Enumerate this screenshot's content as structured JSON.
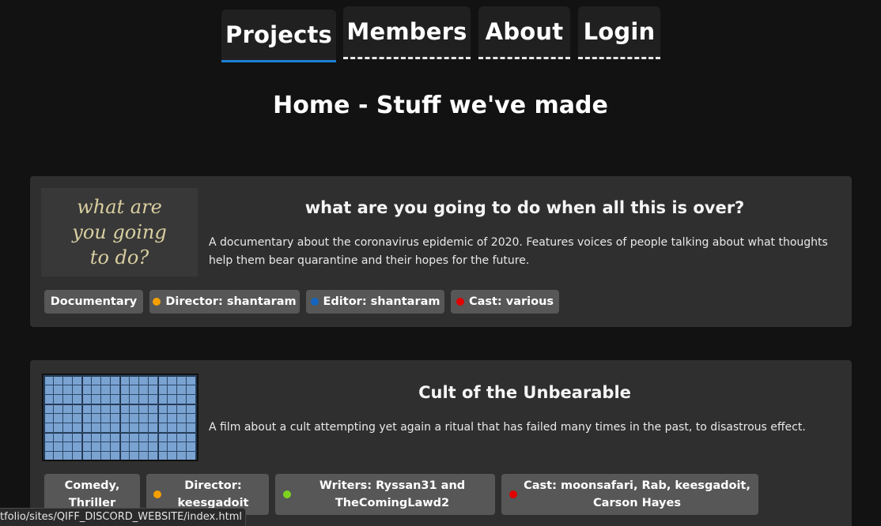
{
  "nav": {
    "tabs": [
      {
        "label": "Projects",
        "active": true
      },
      {
        "label": "Members",
        "active": false
      },
      {
        "label": "About",
        "active": false
      },
      {
        "label": "Login",
        "active": false
      }
    ]
  },
  "page": {
    "heading": "Home - Stuff we've made"
  },
  "projects": [
    {
      "thumbnail_lines": [
        "what are",
        "you going",
        "to do?"
      ],
      "title": "what are you going to do when all this is over?",
      "description": "A documentary about the coronavirus epidemic of 2020. Features voices of people talking about what thoughts help them bear quarantine and their hopes for the future.",
      "tags": [
        {
          "label": "Documentary"
        },
        {
          "label": "Director: shantaram",
          "dot_color": "#f5a000"
        },
        {
          "label": "Editor: shantaram",
          "dot_color": "#1565c0"
        },
        {
          "label": "Cast: various",
          "dot_color": "#e00000"
        }
      ]
    },
    {
      "thumbnail": "blue-grid-image",
      "title": "Cult of the Unbearable",
      "description": "A film about a cult attempting yet again a ritual that has failed many times in the past, to disastrous effect.",
      "tags": [
        {
          "label": "Comedy, Thriller"
        },
        {
          "label": "Director: keesgadoit",
          "dot_color": "#f5a000"
        },
        {
          "label": "Writers: Ryssan31 and TheComingLawd2",
          "dot_color": "#7ed321"
        },
        {
          "label": "Cast: moonsafari, Rab, keesgadoit, Carson Hayes",
          "dot_color": "#e00000"
        }
      ]
    }
  ],
  "statusbar": {
    "text": "tfolio/sites/QIFF_DISCORD_WEBSITE/index.html"
  },
  "colors": {
    "background": "#121212",
    "card": "#2f2f2f",
    "tab": "#202020",
    "active_underline": "#1d7fd4",
    "tag": "#575757"
  }
}
